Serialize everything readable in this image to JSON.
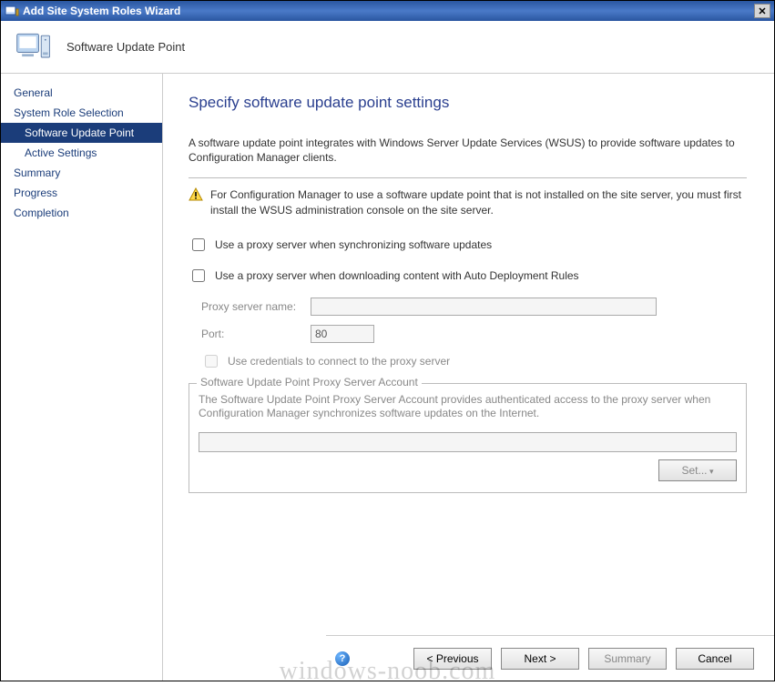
{
  "window": {
    "title": "Add Site System Roles Wizard"
  },
  "header": {
    "title": "Software Update Point"
  },
  "sidebar": {
    "items": [
      {
        "label": "General",
        "sub": false,
        "selected": false
      },
      {
        "label": "System Role Selection",
        "sub": false,
        "selected": false
      },
      {
        "label": "Software Update Point",
        "sub": true,
        "selected": true
      },
      {
        "label": "Active Settings",
        "sub": true,
        "selected": false
      },
      {
        "label": "Summary",
        "sub": false,
        "selected": false
      },
      {
        "label": "Progress",
        "sub": false,
        "selected": false
      },
      {
        "label": "Completion",
        "sub": false,
        "selected": false
      }
    ]
  },
  "page": {
    "heading": "Specify software update point settings",
    "description": "A software update point integrates with Windows Server Update Services (WSUS) to provide software updates to Configuration Manager clients.",
    "warning": "For Configuration Manager to use a software update point that is not installed on the site server, you must first install the WSUS administration console on the site server.",
    "checkboxes": {
      "sync_proxy": "Use a proxy server when synchronizing software updates",
      "download_proxy": "Use a proxy server when downloading content with Auto Deployment Rules"
    },
    "proxy": {
      "name_label": "Proxy server name:",
      "name_value": "",
      "port_label": "Port:",
      "port_value": "80",
      "credentials_label": "Use credentials to connect to the proxy server"
    },
    "group": {
      "legend": "Software Update Point Proxy Server Account",
      "desc": "The Software Update Point Proxy Server Account provides  authenticated access to the proxy server when Configuration Manager synchronizes software updates on the Internet.",
      "account_value": "",
      "set_label": "Set..."
    }
  },
  "footer": {
    "prev": "< Previous",
    "next": "Next >",
    "summary": "Summary",
    "cancel": "Cancel"
  },
  "watermark": "windows-noob.com"
}
